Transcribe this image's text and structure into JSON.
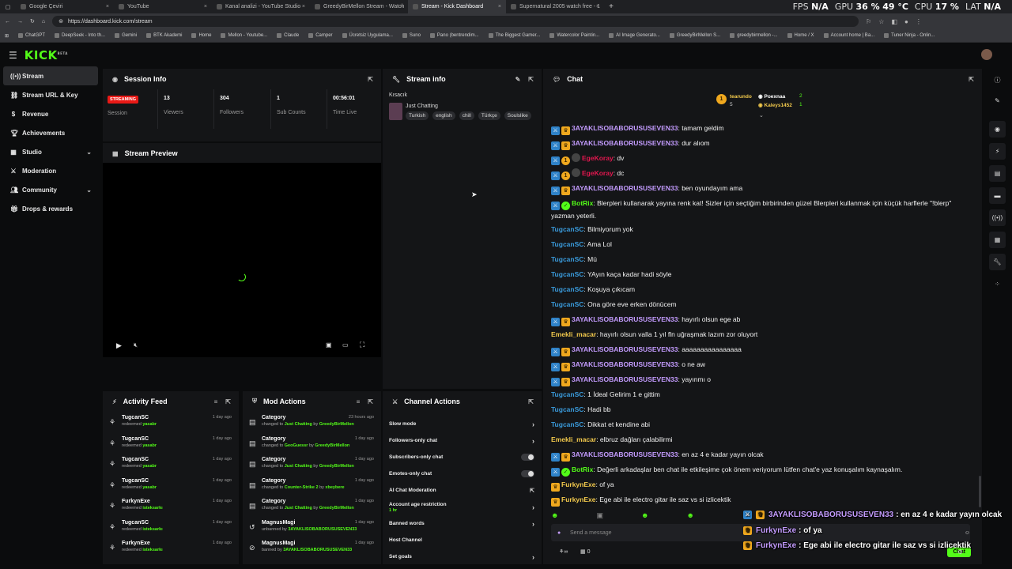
{
  "browser": {
    "tabs": [
      {
        "title": "Google Çeviri",
        "active": false
      },
      {
        "title": "YouTube",
        "active": false
      },
      {
        "title": "Kanal analizi - YouTube Studio",
        "active": false
      },
      {
        "title": "GreedyBirMellon Stream - Watch",
        "active": false
      },
      {
        "title": "Stream - Kick Dashboard",
        "active": true
      },
      {
        "title": "Supernatural 2005 watch free - 1",
        "active": false
      }
    ],
    "url": "https://dashboard.kick.com/stream",
    "bookmarks": [
      "ChatGPT",
      "DeepSeek - Into th...",
      "Gemini",
      "BTK Akademi",
      "Home",
      "Mellon - Youtube...",
      "Claude",
      "Camper",
      "Ücretsiz Uygulama...",
      "Suno",
      "Pano (bentrendim...",
      "The Biggest Gamer...",
      "Watercolor Paintin...",
      "AI Image Generato...",
      "GreedyBirMellon S...",
      "greedybirmellon -...",
      "Home / X",
      "Account home | Ba...",
      "Tuner Ninja - Onlin..."
    ]
  },
  "sysstat": {
    "fps_label": "FPS",
    "fps": "N/A",
    "gpu_label": "GPU",
    "gpu": "36 %",
    "gpu_temp": "49 °C",
    "cpu_label": "CPU",
    "cpu": "17 %",
    "lat_label": "LAT",
    "lat": "N/A"
  },
  "app": {
    "logo": "KICK",
    "logo_badge": "BETA"
  },
  "nav": [
    {
      "label": "Stream",
      "icon": "stream-icon",
      "active": true
    },
    {
      "label": "Stream URL & Key",
      "icon": "link-icon"
    },
    {
      "label": "Revenue",
      "icon": "dollar-icon"
    },
    {
      "label": "Achievements",
      "icon": "trophy-icon"
    },
    {
      "label": "Studio",
      "icon": "studio-icon",
      "expand": true
    },
    {
      "label": "Moderation",
      "icon": "sword-icon"
    },
    {
      "label": "Community",
      "icon": "community-icon",
      "expand": true
    },
    {
      "label": "Drops & rewards",
      "icon": "gift-icon"
    }
  ],
  "session": {
    "title": "Session Info",
    "status": "STREAMING",
    "status_label": "Session",
    "stats": [
      {
        "value": "13",
        "label": "Viewers"
      },
      {
        "value": "304",
        "label": "Followers"
      },
      {
        "value": "1",
        "label": "Sub Counts"
      },
      {
        "value": "00:56:01",
        "label": "Time Live"
      }
    ]
  },
  "preview": {
    "title": "Stream Preview"
  },
  "stream_info": {
    "title": "Stream info",
    "stream_title": "Kısacık",
    "category": "Just Chatting",
    "tags": [
      "Turkish",
      "english",
      "chill",
      "Türkçe",
      "Soulslike"
    ]
  },
  "activity": {
    "title": "Activity Feed",
    "items": [
      {
        "name": "TugcanSC",
        "action": "redeemed",
        "target": "yasabr",
        "time": "1 day ago"
      },
      {
        "name": "TugcanSC",
        "action": "redeemed",
        "target": "yasabr",
        "time": "1 day ago"
      },
      {
        "name": "TugcanSC",
        "action": "redeemed",
        "target": "yasabr",
        "time": "1 day ago"
      },
      {
        "name": "TugcanSC",
        "action": "redeemed",
        "target": "yasabr",
        "time": "1 day ago"
      },
      {
        "name": "FurkynExe",
        "action": "redeemed",
        "target": "isteksarkı",
        "time": "1 day ago"
      },
      {
        "name": "TugcanSC",
        "action": "redeemed",
        "target": "isteksarkı",
        "time": "1 day ago"
      },
      {
        "name": "FurkynExe",
        "action": "redeemed",
        "target": "isteksarkı",
        "time": "1 day ago"
      }
    ]
  },
  "mod_actions": {
    "title": "Mod Actions",
    "items": [
      {
        "name": "Category",
        "pre": "changed to",
        "val": "Just Chatting",
        "by": "by",
        "who": "GreedyBirMellon",
        "time": "23 hours ago"
      },
      {
        "name": "Category",
        "pre": "changed to",
        "val": "GeoGuessr",
        "by": "by",
        "who": "GreedyBirMellon",
        "time": "1 day ago"
      },
      {
        "name": "Category",
        "pre": "changed to",
        "val": "Just Chatting",
        "by": "by",
        "who": "GreedyBirMellon",
        "time": "1 day ago"
      },
      {
        "name": "Category",
        "pre": "changed to",
        "val": "Counter-Strike 2",
        "by": "by",
        "who": "xbeybere",
        "time": "1 day ago"
      },
      {
        "name": "Category",
        "pre": "changed to",
        "val": "Just Chatting",
        "by": "by",
        "who": "GreedyBirMellon",
        "time": "1 day ago"
      },
      {
        "name": "MagnusMagi",
        "pre": "unbanned by",
        "val": "3AYAKLISOBABORUSUSEVEN33",
        "by": "",
        "who": "",
        "time": "1 day ago"
      },
      {
        "name": "MagnusMagi",
        "pre": "banned by",
        "val": "3AYAKLISOBABORUSUSEVEN33",
        "by": "",
        "who": "",
        "time": "1 day ago"
      }
    ]
  },
  "channel_actions": {
    "title": "Channel Actions",
    "items": [
      {
        "label": "Slow mode",
        "ctl": "chevron"
      },
      {
        "label": "Followers-only chat",
        "ctl": "chevron"
      },
      {
        "label": "Subscribers-only chat",
        "ctl": "toggle"
      },
      {
        "label": "Emotes-only chat",
        "ctl": "toggle"
      },
      {
        "label": "AI Chat Moderation",
        "ctl": "external"
      },
      {
        "label": "Account age restriction",
        "sub": "1 hr",
        "ctl": "chevron"
      },
      {
        "label": "Banned words",
        "ctl": "chevron"
      },
      {
        "label": "Host Channel",
        "ctl": ""
      },
      {
        "label": "Set goals",
        "ctl": "chevron"
      }
    ]
  },
  "chat": {
    "title": "Chat",
    "pinned": [
      {
        "name": "tearundo",
        "count": "5",
        "rank": "1"
      },
      {
        "name": "Poexnaa",
        "count": "2"
      },
      {
        "name": "Kaleys1452",
        "count": "1"
      }
    ],
    "messages": [
      {
        "user": "3AYAKLISOBABORUSUSEVEN33",
        "color": "#c49cff",
        "badges": [
          "mod",
          "crown"
        ],
        "text": ": tamam geldim"
      },
      {
        "user": "3AYAKLISOBABORUSUSEVEN33",
        "color": "#c49cff",
        "badges": [
          "mod",
          "crown"
        ],
        "text": ": dur alıom"
      },
      {
        "user": "EgeKoray",
        "color": "#e3174f",
        "badges": [
          "mod",
          "one",
          "dev"
        ],
        "text": ": dv"
      },
      {
        "user": "EgeKoray",
        "color": "#e3174f",
        "badges": [
          "mod",
          "one",
          "dev"
        ],
        "text": ": dc"
      },
      {
        "user": "3AYAKLISOBABORUSUSEVEN33",
        "color": "#c49cff",
        "badges": [
          "mod",
          "crown"
        ],
        "text": ": ben oyundayım ama"
      },
      {
        "user": "BotRix",
        "color": "#53fc18",
        "badges": [
          "mod",
          "ver"
        ],
        "text": ": Blerpleri kullanarak yayına renk kat! Sizler için seçtiğim birbirinden güzel Blerpleri kullanmak için küçük harflerle \"!blerp\" yazman yeterli."
      },
      {
        "user": "TugcanSC",
        "color": "#3a9bdc",
        "badges": [],
        "text": ": Bilmiyorum yok"
      },
      {
        "user": "TugcanSC",
        "color": "#3a9bdc",
        "badges": [],
        "text": ": Ama Lol"
      },
      {
        "user": "TugcanSC",
        "color": "#3a9bdc",
        "badges": [],
        "text": ": Mü"
      },
      {
        "user": "TugcanSC",
        "color": "#3a9bdc",
        "badges": [],
        "text": ": YAyın kaça kadar hadi söyle"
      },
      {
        "user": "TugcanSC",
        "color": "#3a9bdc",
        "badges": [],
        "text": ": Koşuya çıkıcam"
      },
      {
        "user": "TugcanSC",
        "color": "#3a9bdc",
        "badges": [],
        "text": ": Ona göre eve erken dönücem"
      },
      {
        "user": "3AYAKLISOBABORUSUSEVEN33",
        "color": "#c49cff",
        "badges": [
          "mod",
          "crown"
        ],
        "text": ": hayırlı olsun ege ab"
      },
      {
        "user": "Emekli_macar",
        "color": "#f2c94c",
        "badges": [],
        "text": ": hayırlı olsun valla 1 yıl fln uğraşmak lazım zor oluyort"
      },
      {
        "user": "3AYAKLISOBABORUSUSEVEN33",
        "color": "#c49cff",
        "badges": [
          "mod",
          "crown"
        ],
        "text": ": aaaaaaaaaaaaaaaa"
      },
      {
        "user": "3AYAKLISOBABORUSUSEVEN33",
        "color": "#c49cff",
        "badges": [
          "mod",
          "crown"
        ],
        "text": ": o ne aw"
      },
      {
        "user": "3AYAKLISOBABORUSUSEVEN33",
        "color": "#c49cff",
        "badges": [
          "mod",
          "crown"
        ],
        "text": ": yayınmı o"
      },
      {
        "user": "TugcanSC",
        "color": "#3a9bdc",
        "badges": [],
        "text": ": 1 İdeal Gelirim 1 e gittim"
      },
      {
        "user": "TugcanSC",
        "color": "#3a9bdc",
        "badges": [],
        "text": ": Hadi bb"
      },
      {
        "user": "TugcanSC",
        "color": "#3a9bdc",
        "badges": [],
        "text": ": Dikkat et kendine abi"
      },
      {
        "user": "Emekli_macar",
        "color": "#f2c94c",
        "badges": [],
        "text": ": elbruz dağları çalabilirmi"
      },
      {
        "user": "3AYAKLISOBABORUSUSEVEN33",
        "color": "#c49cff",
        "badges": [
          "mod",
          "crown"
        ],
        "text": ": en az 4 e kadar yayın olcak"
      },
      {
        "user": "BotRix",
        "color": "#53fc18",
        "badges": [
          "mod",
          "ver"
        ],
        "text": ": Değerli arkadaşlar ben chat ile etkileşime çok önem veriyorum lütfen chat'e yaz konuşalım kaynaşalım."
      },
      {
        "user": "FurkynExe",
        "color": "#f2c94c",
        "badges": [
          "crown"
        ],
        "text": ": of ya"
      },
      {
        "user": "FurkynExe",
        "color": "#f2c94c",
        "badges": [
          "crown"
        ],
        "text": ": Ege abi ile electro gitar ile saz vs si izlicektik"
      }
    ],
    "input_placeholder": "Send a message",
    "points": "0",
    "send_label": "Chat"
  },
  "overlay": [
    {
      "user": "3AYAKLISOBABORUSUSEVEN33",
      "color": "#c49cff",
      "text": ": en az 4 e kadar yayın olcak"
    },
    {
      "user": "FurkynExe",
      "color": "#c49cff",
      "text": ": of ya"
    },
    {
      "user": "FurkynExe",
      "color": "#c49cff",
      "text": ": Ege abi ile electro gitar ile saz vs si izlicektik"
    }
  ]
}
